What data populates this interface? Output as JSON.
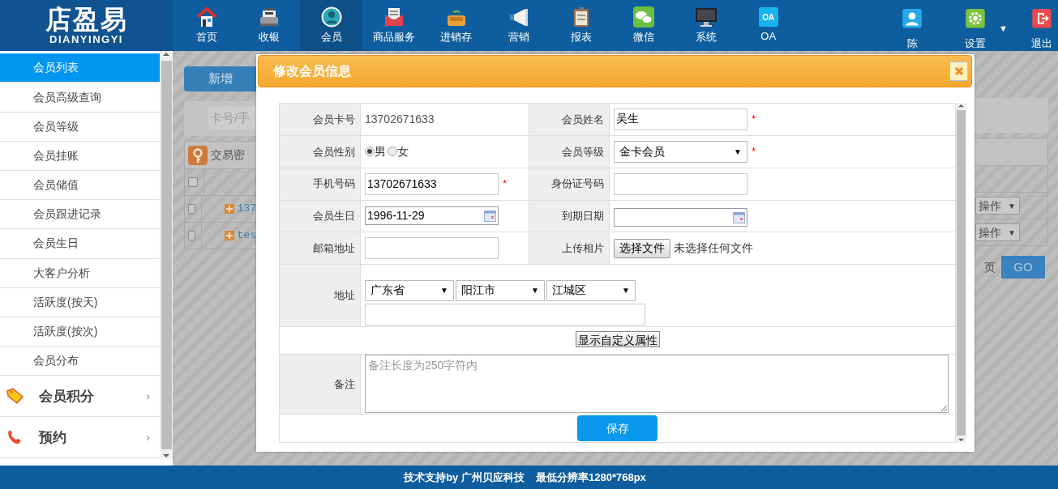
{
  "header": {
    "logo": "店盈易",
    "logo_subtitle": "DIANYINGYI",
    "nav": [
      {
        "label": "首页",
        "selected": false
      },
      {
        "label": "收银",
        "selected": false
      },
      {
        "label": "会员",
        "selected": true
      },
      {
        "label": "商品服务",
        "selected": false
      },
      {
        "label": "进销存",
        "selected": false
      },
      {
        "label": "营销",
        "selected": false
      },
      {
        "label": "报表",
        "selected": false
      },
      {
        "label": "微信",
        "selected": false
      },
      {
        "label": "系统",
        "selected": false
      },
      {
        "label": "OA",
        "selected": false,
        "badge": "OA"
      }
    ],
    "user_menu": [
      {
        "label": "陈"
      },
      {
        "label": "设置",
        "caret": "▼"
      },
      {
        "label": "退出"
      }
    ]
  },
  "sidebar": {
    "items": [
      {
        "label": "会员列表",
        "selected": true
      },
      {
        "label": "会员高级查询",
        "selected": false
      },
      {
        "label": "会员等级",
        "selected": false
      },
      {
        "label": "会员挂账",
        "selected": false
      },
      {
        "label": "会员储值",
        "selected": false
      },
      {
        "label": "会员跟进记录",
        "selected": false
      },
      {
        "label": "会员生日",
        "selected": false
      },
      {
        "label": "大客户分析",
        "selected": false
      },
      {
        "label": "活跃度(按天)",
        "selected": false
      },
      {
        "label": "活跃度(按次)",
        "selected": false
      },
      {
        "label": "会员分布",
        "selected": false
      }
    ],
    "groups": [
      {
        "label": "会员积分",
        "chevron": "›"
      },
      {
        "label": "预约",
        "chevron": "›"
      }
    ]
  },
  "background": {
    "add_button": "新增",
    "search_placeholder": "卡号/手",
    "panel_title": "交易密",
    "select_all": {
      "checked": false
    },
    "rows": [
      {
        "checked": false,
        "text": "137",
        "action": "操作",
        "caret": "▼"
      },
      {
        "checked": false,
        "text": "tes",
        "action": "操作",
        "caret": "▼"
      }
    ],
    "page_label": "页",
    "go_button": "GO"
  },
  "dialog": {
    "title": "修改会员信息",
    "rows": [
      [
        {
          "label": "会员卡号",
          "kind": "text",
          "value": "13702671633"
        },
        {
          "label": "会员姓名",
          "kind": "input",
          "value": "吴生",
          "required": "*"
        }
      ],
      [
        {
          "label": "会员性别",
          "kind": "radio",
          "options": [
            {
              "label": "男",
              "selected": true
            },
            {
              "label": "女",
              "selected": false
            }
          ]
        },
        {
          "label": "会员等级",
          "kind": "select",
          "value": "金卡会员",
          "caret": "▼",
          "required": "*"
        }
      ],
      [
        {
          "label": "手机号码",
          "kind": "input",
          "value": "13702671633",
          "required": "*"
        },
        {
          "label": "身份证号码",
          "kind": "input"
        }
      ],
      [
        {
          "label": "会员生日",
          "kind": "date",
          "value": "1996-11-29"
        },
        {
          "label": "到期日期",
          "kind": "date"
        }
      ],
      [
        {
          "label": "邮箱地址",
          "kind": "input"
        },
        {
          "label": "上传相片",
          "kind": "file",
          "button": "选择文件",
          "status": "未选择任何文件"
        }
      ]
    ],
    "address": {
      "label": "地址",
      "selects": [
        {
          "value": "广东省",
          "caret": "▼"
        },
        {
          "value": "阳江市",
          "caret": "▼"
        },
        {
          "value": "江城区",
          "caret": "▼"
        }
      ]
    },
    "custom_button": "显示自定义属性",
    "remark": {
      "label": "备注",
      "placeholder": "备注长度为250字符内"
    },
    "save_button": "保存"
  },
  "footer": [
    "技术支持by 广州贝应科技",
    "最低分辨率1280*768px"
  ]
}
